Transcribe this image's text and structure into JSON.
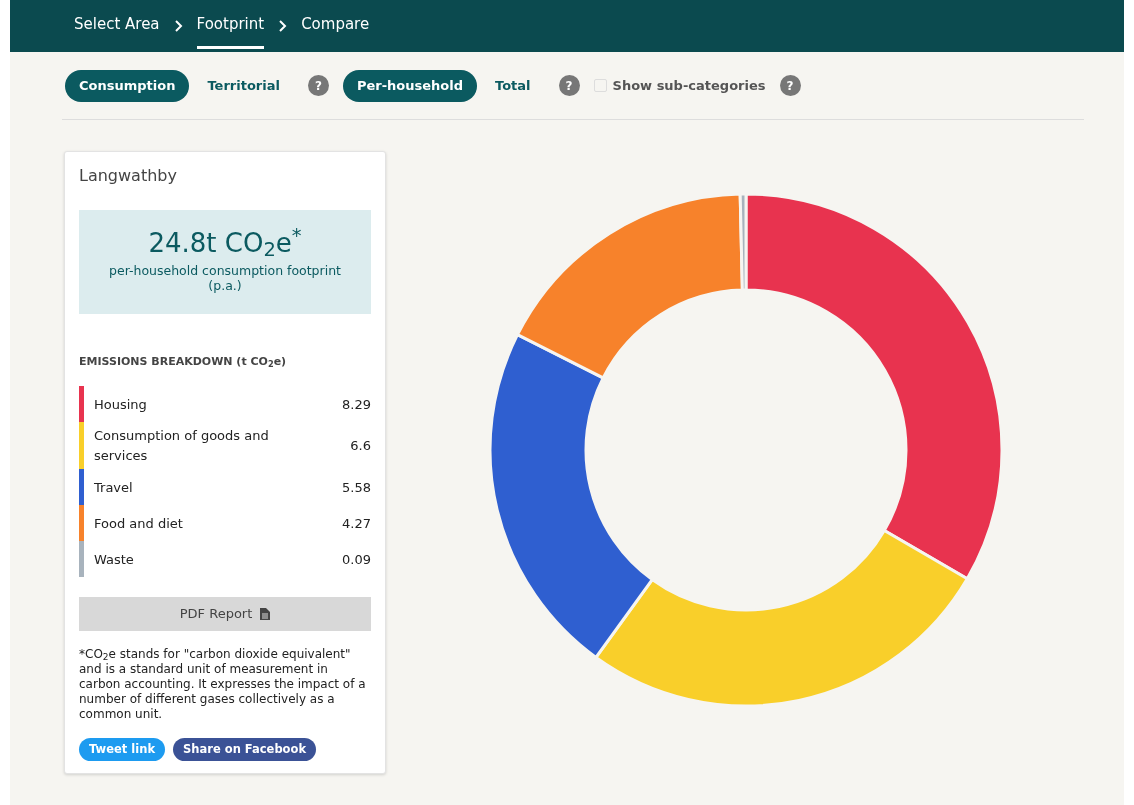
{
  "breadcrumb": [
    {
      "label": "Select Area",
      "selected": false
    },
    {
      "label": "Footprint",
      "selected": true
    },
    {
      "label": "Compare",
      "selected": false
    }
  ],
  "toolbar": [
    {
      "kind": "toggle",
      "label": "Consumption",
      "selected": true
    },
    {
      "kind": "toggle",
      "label": "Territorial",
      "selected": false
    },
    {
      "kind": "help",
      "label": "?"
    },
    {
      "kind": "toggle",
      "label": "Per-household",
      "selected": true
    },
    {
      "kind": "toggle",
      "label": "Total",
      "selected": false
    },
    {
      "kind": "help",
      "label": "?"
    },
    {
      "kind": "checkbox",
      "label": "Show sub-categories",
      "checked": false
    },
    {
      "kind": "help",
      "label": "?"
    }
  ],
  "panel": {
    "place": "Langwathby",
    "headline": "24.8t CO$_{2}$e$^{*}$",
    "headline_caption": "per-household consumption footprint (p.a.)",
    "breakdown_title": "EMISSIONS BREAKDOWN (t CO$_{2}$e)",
    "breakdown": [
      {
        "label": "Housing",
        "value": "8.29",
        "color": "#e8334f"
      },
      {
        "label": "Consumption of goods and services",
        "value": "6.6",
        "color": "#f9cf2a"
      },
      {
        "label": "Travel",
        "value": "5.58",
        "color": "#2f5fd0"
      },
      {
        "label": "Food and diet",
        "value": "4.27",
        "color": "#f7822b"
      },
      {
        "label": "Waste",
        "value": "0.09",
        "color": "#a8b3bd"
      }
    ],
    "pdf_button": "PDF Report",
    "footnote": "*CO$_{2}$e stands for \"carbon dioxide equivalent\" and is a standard unit of measurement in carbon accounting. It expresses the impact of a number of different gases collectively as a common unit.",
    "share_buttons": [
      {
        "kind": "twitter",
        "label": "Tweet link"
      },
      {
        "kind": "facebook",
        "label": "Share on Facebook"
      }
    ]
  }
}
